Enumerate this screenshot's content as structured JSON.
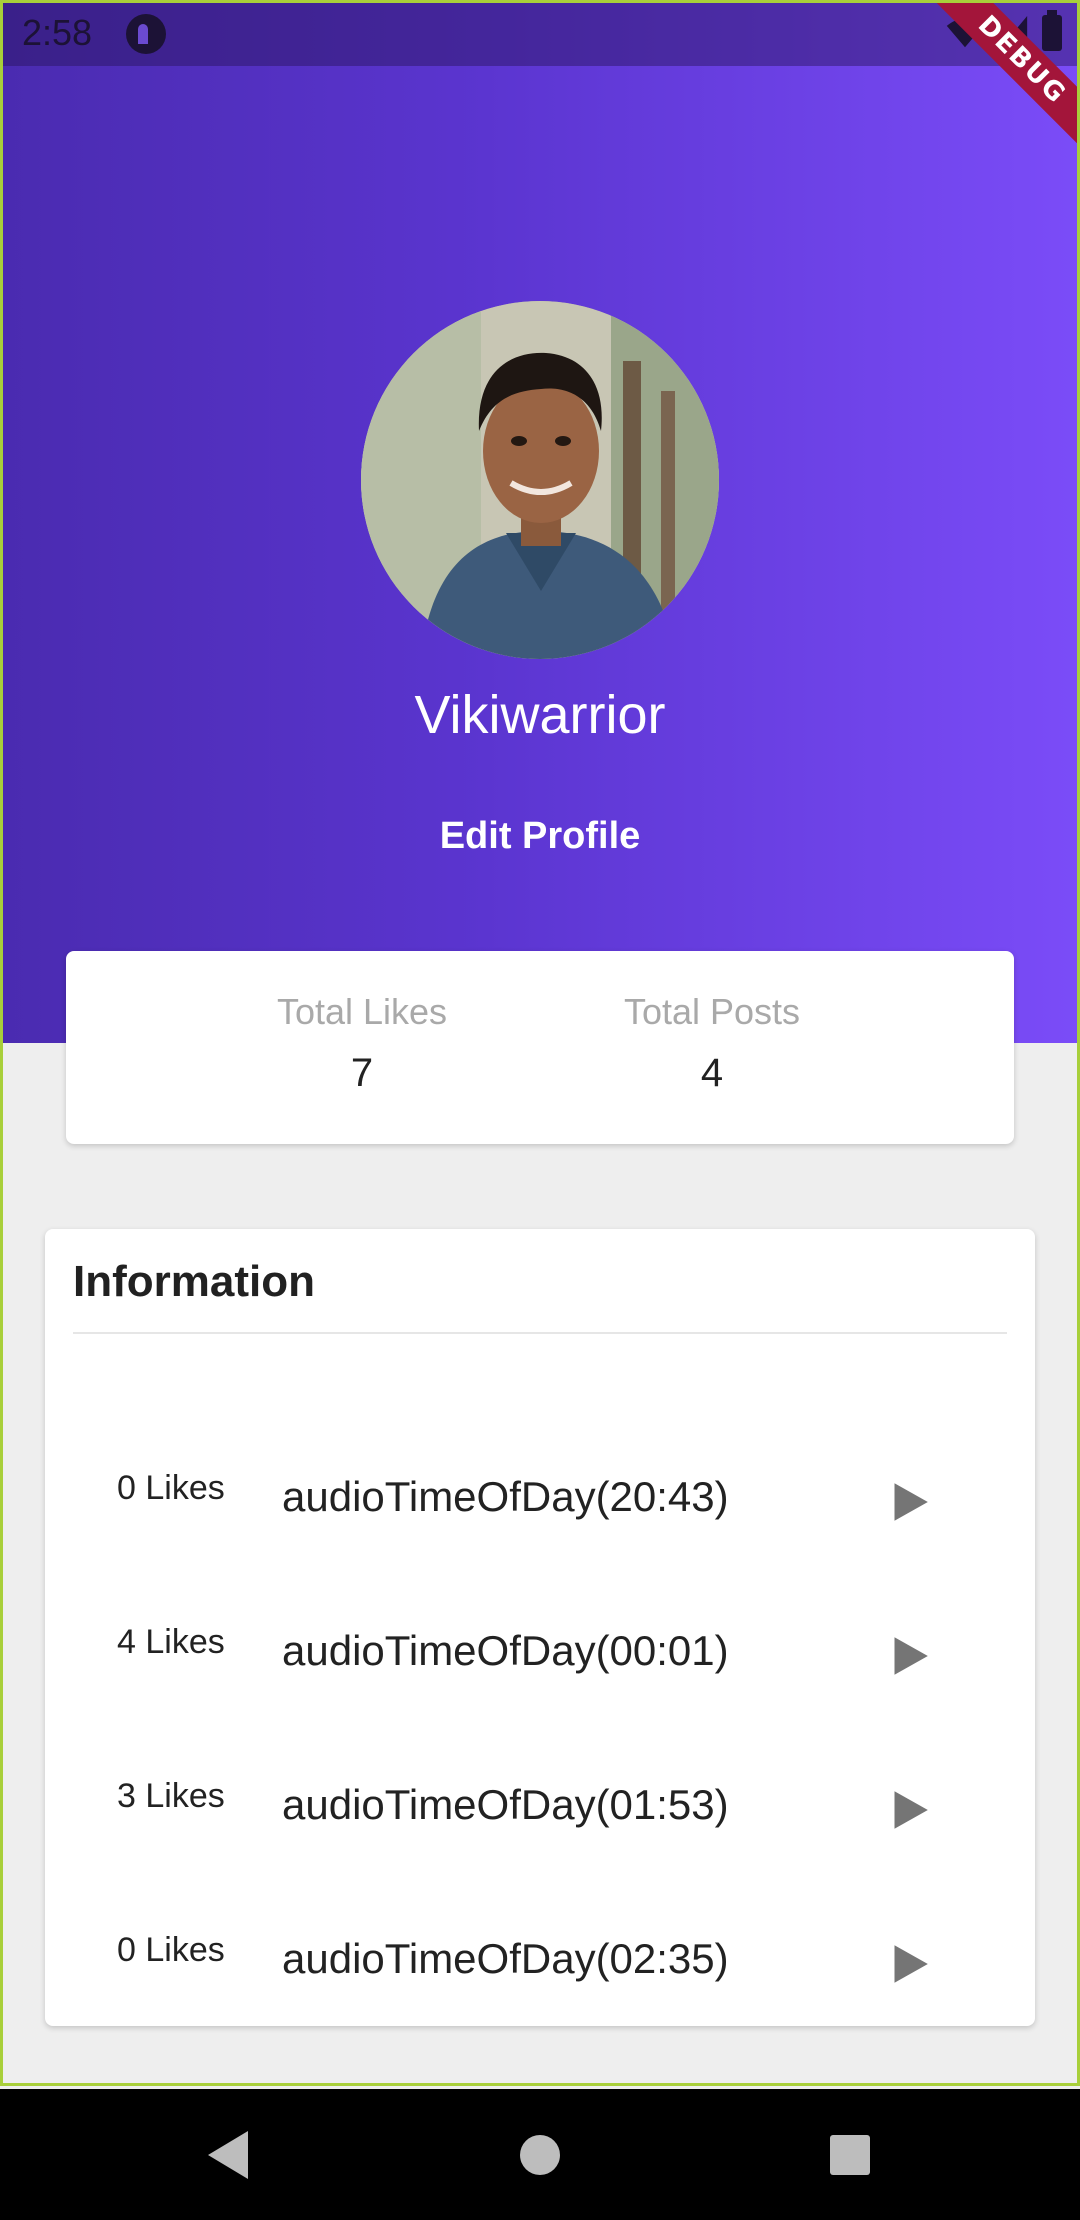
{
  "status_bar": {
    "time": "2:58",
    "debug_label": "DEBUG"
  },
  "profile": {
    "username": "Vikiwarrior",
    "edit_label": "Edit Profile"
  },
  "stats": {
    "likes_label": "Total Likes",
    "likes_value": "7",
    "posts_label": "Total Posts",
    "posts_value": "4"
  },
  "information": {
    "title": "Information",
    "posts": [
      {
        "likes": "0 Likes",
        "title": "audioTimeOfDay(20:43)"
      },
      {
        "likes": "4 Likes",
        "title": "audioTimeOfDay(00:01)"
      },
      {
        "likes": "3 Likes",
        "title": "audioTimeOfDay(01:53)"
      },
      {
        "likes": "0 Likes",
        "title": "audioTimeOfDay(02:35)"
      }
    ]
  },
  "colors": {
    "header_gradient_start": "#4a2bb0",
    "header_gradient_end": "#7b4cf8",
    "debug_ribbon": "#a3153a",
    "background": "#eeeeee"
  },
  "icons": {
    "play": "play-icon",
    "nav_back": "back-icon",
    "nav_home": "home-icon",
    "nav_recent": "recent-apps-icon"
  }
}
